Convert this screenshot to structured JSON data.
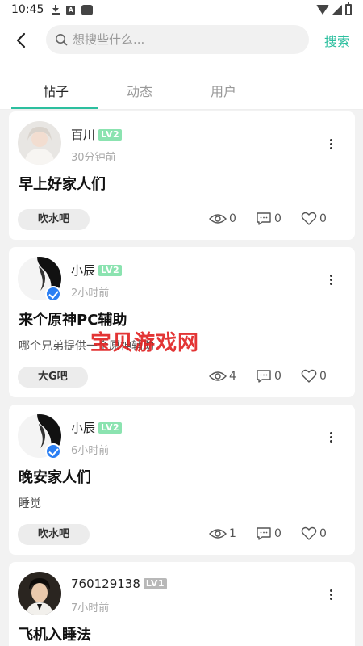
{
  "status_bar": {
    "time": "10:45",
    "a_icon_text": "A"
  },
  "search": {
    "placeholder": "想搜些什么...",
    "button_label": "搜索"
  },
  "tabs": [
    {
      "label": "帖子",
      "active": true
    },
    {
      "label": "动态",
      "active": false
    },
    {
      "label": "用户",
      "active": false
    }
  ],
  "posts": [
    {
      "username": "百川",
      "level": "LV2",
      "time": "30分钟前",
      "title": "早上好家人们",
      "body": "",
      "tag": "吹水吧",
      "views": "0",
      "comments": "0",
      "likes": "0",
      "verified": false
    },
    {
      "username": "小辰",
      "level": "LV2",
      "time": "2小时前",
      "title": "来个原神PC辅助",
      "body": "哪个兄弟提供一个原神辅助",
      "tag": "大G吧",
      "views": "4",
      "comments": "0",
      "likes": "0",
      "verified": true
    },
    {
      "username": "小辰",
      "level": "LV2",
      "time": "6小时前",
      "title": "晚安家人们",
      "body": "睡觉",
      "tag": "吹水吧",
      "views": "1",
      "comments": "0",
      "likes": "0",
      "verified": true
    },
    {
      "username": "760129138",
      "level": "LV1",
      "time": "7小时前",
      "title": "飞机入睡法",
      "body": "",
      "tag": "",
      "views": "",
      "comments": "",
      "likes": "",
      "verified": false
    }
  ],
  "watermark": "宝贝游戏网",
  "colors": {
    "accent": "#2cbf9f",
    "level_badge": "#8be3b0",
    "verified": "#2b7ff3",
    "watermark": "#e02020"
  }
}
